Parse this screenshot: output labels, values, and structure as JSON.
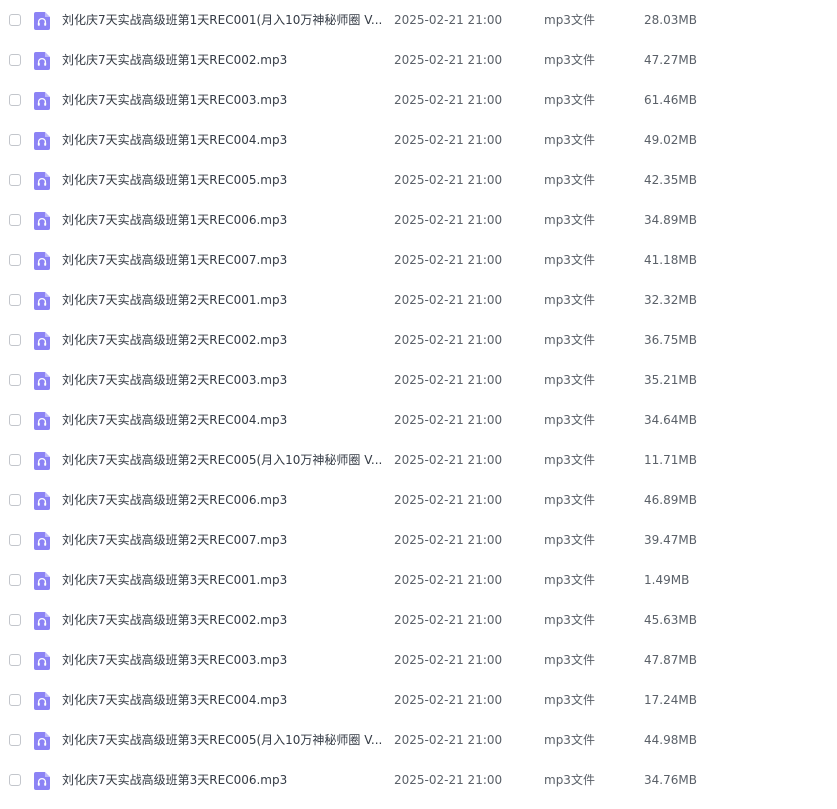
{
  "files": [
    {
      "name": "刘化庆7天实战高级班第1天REC001(月入10万神秘师圈 V...",
      "date": "2025-02-21 21:00",
      "type": "mp3文件",
      "size": "28.03MB",
      "icon": "audio-file-icon"
    },
    {
      "name": "刘化庆7天实战高级班第1天REC002.mp3",
      "date": "2025-02-21 21:00",
      "type": "mp3文件",
      "size": "47.27MB",
      "icon": "audio-file-icon"
    },
    {
      "name": "刘化庆7天实战高级班第1天REC003.mp3",
      "date": "2025-02-21 21:00",
      "type": "mp3文件",
      "size": "61.46MB",
      "icon": "audio-file-icon"
    },
    {
      "name": "刘化庆7天实战高级班第1天REC004.mp3",
      "date": "2025-02-21 21:00",
      "type": "mp3文件",
      "size": "49.02MB",
      "icon": "audio-file-icon"
    },
    {
      "name": "刘化庆7天实战高级班第1天REC005.mp3",
      "date": "2025-02-21 21:00",
      "type": "mp3文件",
      "size": "42.35MB",
      "icon": "audio-file-icon"
    },
    {
      "name": "刘化庆7天实战高级班第1天REC006.mp3",
      "date": "2025-02-21 21:00",
      "type": "mp3文件",
      "size": "34.89MB",
      "icon": "audio-file-icon"
    },
    {
      "name": "刘化庆7天实战高级班第1天REC007.mp3",
      "date": "2025-02-21 21:00",
      "type": "mp3文件",
      "size": "41.18MB",
      "icon": "audio-file-icon"
    },
    {
      "name": "刘化庆7天实战高级班第2天REC001.mp3",
      "date": "2025-02-21 21:00",
      "type": "mp3文件",
      "size": "32.32MB",
      "icon": "audio-file-icon"
    },
    {
      "name": "刘化庆7天实战高级班第2天REC002.mp3",
      "date": "2025-02-21 21:00",
      "type": "mp3文件",
      "size": "36.75MB",
      "icon": "audio-file-icon"
    },
    {
      "name": "刘化庆7天实战高级班第2天REC003.mp3",
      "date": "2025-02-21 21:00",
      "type": "mp3文件",
      "size": "35.21MB",
      "icon": "audio-file-icon"
    },
    {
      "name": "刘化庆7天实战高级班第2天REC004.mp3",
      "date": "2025-02-21 21:00",
      "type": "mp3文件",
      "size": "34.64MB",
      "icon": "audio-file-icon"
    },
    {
      "name": "刘化庆7天实战高级班第2天REC005(月入10万神秘师圈 V...",
      "date": "2025-02-21 21:00",
      "type": "mp3文件",
      "size": "11.71MB",
      "icon": "audio-file-icon"
    },
    {
      "name": "刘化庆7天实战高级班第2天REC006.mp3",
      "date": "2025-02-21 21:00",
      "type": "mp3文件",
      "size": "46.89MB",
      "icon": "audio-file-icon"
    },
    {
      "name": "刘化庆7天实战高级班第2天REC007.mp3",
      "date": "2025-02-21 21:00",
      "type": "mp3文件",
      "size": "39.47MB",
      "icon": "audio-file-icon"
    },
    {
      "name": "刘化庆7天实战高级班第3天REC001.mp3",
      "date": "2025-02-21 21:00",
      "type": "mp3文件",
      "size": "1.49MB",
      "icon": "audio-file-icon"
    },
    {
      "name": "刘化庆7天实战高级班第3天REC002.mp3",
      "date": "2025-02-21 21:00",
      "type": "mp3文件",
      "size": "45.63MB",
      "icon": "audio-file-icon"
    },
    {
      "name": "刘化庆7天实战高级班第3天REC003.mp3",
      "date": "2025-02-21 21:00",
      "type": "mp3文件",
      "size": "47.87MB",
      "icon": "audio-file-icon"
    },
    {
      "name": "刘化庆7天实战高级班第3天REC004.mp3",
      "date": "2025-02-21 21:00",
      "type": "mp3文件",
      "size": "17.24MB",
      "icon": "audio-file-icon"
    },
    {
      "name": "刘化庆7天实战高级班第3天REC005(月入10万神秘师圈 V...",
      "date": "2025-02-21 21:00",
      "type": "mp3文件",
      "size": "44.98MB",
      "icon": "audio-file-icon"
    },
    {
      "name": "刘化庆7天实战高级班第3天REC006.mp3",
      "date": "2025-02-21 21:00",
      "type": "mp3文件",
      "size": "34.76MB",
      "icon": "audio-file-icon"
    }
  ],
  "colors": {
    "icon_fill": "#8c83f5",
    "text_primary": "#333a44",
    "text_secondary": "#5a6068",
    "checkbox_border": "#c3c6cc"
  }
}
